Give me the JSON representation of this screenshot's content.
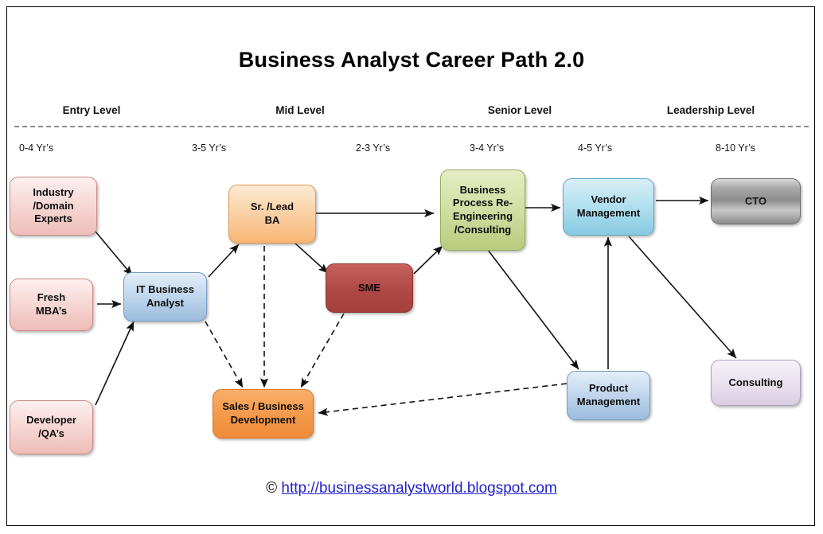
{
  "title": "Business Analyst Career Path 2.0",
  "levels": [
    {
      "label": "Entry Level"
    },
    {
      "label": "Mid Level"
    },
    {
      "label": "Senior Level"
    },
    {
      "label": "Leadership Level"
    }
  ],
  "years": [
    {
      "label": "0-4 Yr’s"
    },
    {
      "label": "3-5 Yr’s"
    },
    {
      "label": "2-3 Yr’s"
    },
    {
      "label": "3-4 Yr’s"
    },
    {
      "label": "4-5 Yr’s"
    },
    {
      "label": "8-10 Yr’s"
    }
  ],
  "nodes": [
    {
      "id": "industry-domain-experts",
      "label": "Industry\n/Domain\nExperts",
      "color": "#eebdb8"
    },
    {
      "id": "fresh-mbas",
      "label": "Fresh\nMBA’s",
      "color": "#eebdb8"
    },
    {
      "id": "developer-qas",
      "label": "Developer\n/QA’s",
      "color": "#eebdb8"
    },
    {
      "id": "it-business-analyst",
      "label": "IT Business\nAnalyst",
      "color": "#9cbcdd"
    },
    {
      "id": "sr-lead-ba",
      "label": "Sr. /Lead\nBA",
      "color": "#f7b575"
    },
    {
      "id": "sme",
      "label": "SME",
      "color": "#a33f3c"
    },
    {
      "id": "sales-business-development",
      "label": "Sales / Business\nDevelopment",
      "color": "#ef8b38"
    },
    {
      "id": "business-process-re-engineering",
      "label": "Business\nProcess Re-\nEngineering\n/Consulting",
      "color": "#b9cb7e"
    },
    {
      "id": "vendor-management",
      "label": "Vendor\nManagement",
      "color": "#87cbe2"
    },
    {
      "id": "product-management",
      "label": "Product\nManagement",
      "color": "#9cbcdd"
    },
    {
      "id": "cto",
      "label": "CTO",
      "color": "#8e8e8e"
    },
    {
      "id": "consulting",
      "label": "Consulting",
      "color": "#d9cfe2"
    }
  ],
  "edges": [
    {
      "from": "industry-domain-experts",
      "to": "it-business-analyst",
      "style": "solid"
    },
    {
      "from": "fresh-mbas",
      "to": "it-business-analyst",
      "style": "solid"
    },
    {
      "from": "developer-qas",
      "to": "it-business-analyst",
      "style": "solid"
    },
    {
      "from": "it-business-analyst",
      "to": "sr-lead-ba",
      "style": "solid"
    },
    {
      "from": "it-business-analyst",
      "to": "sales-business-development",
      "style": "dashed"
    },
    {
      "from": "sr-lead-ba",
      "to": "sme",
      "style": "solid"
    },
    {
      "from": "sr-lead-ba",
      "to": "business-process-re-engineering",
      "style": "solid"
    },
    {
      "from": "sr-lead-ba",
      "to": "sales-business-development",
      "style": "dashed"
    },
    {
      "from": "sme",
      "to": "business-process-re-engineering",
      "style": "solid"
    },
    {
      "from": "sme",
      "to": "sales-business-development",
      "style": "dashed"
    },
    {
      "from": "business-process-re-engineering",
      "to": "vendor-management",
      "style": "solid"
    },
    {
      "from": "business-process-re-engineering",
      "to": "product-management",
      "style": "solid"
    },
    {
      "from": "product-management",
      "to": "vendor-management",
      "style": "solid"
    },
    {
      "from": "product-management",
      "to": "sales-business-development",
      "style": "dashed"
    },
    {
      "from": "vendor-management",
      "to": "cto",
      "style": "solid"
    },
    {
      "from": "vendor-management",
      "to": "consulting",
      "style": "solid"
    }
  ],
  "footer": {
    "copyright": "©",
    "url": "http://businessanalystworld.blogspot.com"
  }
}
